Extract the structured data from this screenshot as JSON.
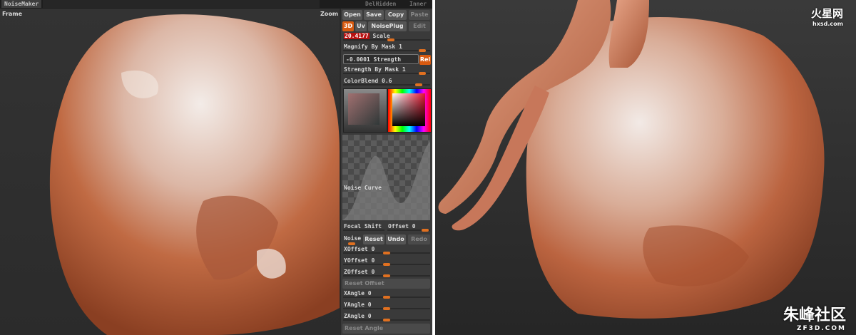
{
  "topbar": {
    "title": "NoiseMaker",
    "btn_dehidden": "DelHidden",
    "btn_inner": "Inner"
  },
  "viewport": {
    "frame_label": "Frame",
    "zoom_label": "Zoom"
  },
  "panel": {
    "buttons": {
      "open": "Open",
      "save": "Save",
      "copy": "Copy",
      "paste": "Paste"
    },
    "tabs": {
      "t3d": "3D",
      "uv": "Uv",
      "noiseplug": "NoisePlug",
      "edit": "Edit"
    },
    "scale": {
      "value": "20.4177",
      "label": "Scale"
    },
    "magnify_by_mask": {
      "label": "Magnify By Mask",
      "value": "1",
      "level": 0.95
    },
    "strength": {
      "value": "-0.0001",
      "label": "Strength",
      "rel_label": "Rel"
    },
    "strength_by_mask": {
      "label": "Strength By Mask",
      "value": "1",
      "level": 0.95
    },
    "color_blend": {
      "label": "ColorBlend",
      "value": "0.6",
      "level": 0.9
    },
    "noise_curve_label": "Noise Curve",
    "focal_shift": {
      "label": "Focal Shift"
    },
    "offset": {
      "label": "Offset",
      "value": "0"
    },
    "noise_row": {
      "noise": "Noise",
      "reset": "Reset",
      "undo": "Undo",
      "redo": "Redo"
    },
    "xoffset": {
      "label": "XOffset",
      "value": "0",
      "level": 0.5
    },
    "yoffset": {
      "label": "YOffset",
      "value": "0",
      "level": 0.5
    },
    "zoffset": {
      "label": "ZOffset",
      "value": "0",
      "level": 0.5
    },
    "reset_offset": "Reset Offset",
    "xangle": {
      "label": "XAngle",
      "value": "0",
      "level": 0.5
    },
    "yangle": {
      "label": "YAngle",
      "value": "0",
      "level": 0.5
    },
    "zangle": {
      "label": "ZAngle",
      "value": "0",
      "level": 0.5
    },
    "reset_angle": "Reset Angle"
  },
  "watermarks": {
    "hxsd_cn": "火星网",
    "hxsd_url": "hxsd.com",
    "zf3d_cn": "朱峰社区",
    "zf3d_url": "ZF3D.COM"
  },
  "colors": {
    "accent": "#e07020",
    "rock": "#b85a3a",
    "panel": "#3a3a3a"
  }
}
